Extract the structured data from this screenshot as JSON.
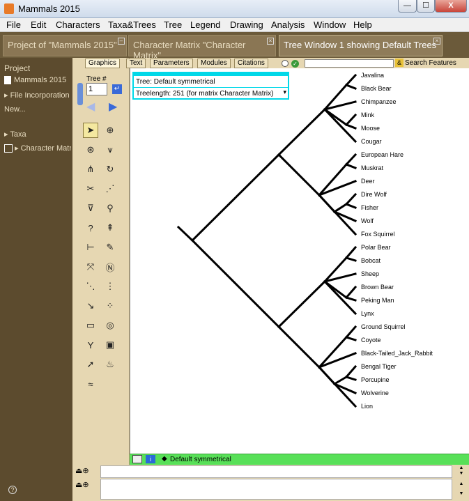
{
  "window": {
    "title": "Mammals 2015",
    "min_label": "—",
    "max_label": "☐",
    "close_label": "X"
  },
  "menu": [
    "File",
    "Edit",
    "Characters",
    "Taxa&Trees",
    "Tree",
    "Legend",
    "Drawing",
    "Analysis",
    "Window",
    "Help"
  ],
  "project_tabs": [
    {
      "label": "Project of \"Mammals 2015\""
    },
    {
      "label": "Character Matrix \"Character Matrix\""
    },
    {
      "label": "Tree Window 1 showing Default Trees"
    }
  ],
  "sidebar": {
    "project": "Project",
    "file": "Mammals 2015",
    "file_inc": "File Incorporation",
    "new": "New...",
    "taxa": "Taxa",
    "charmat": "Character Matrix"
  },
  "tree_num": {
    "label": "Tree #",
    "value": "1"
  },
  "subtabs": [
    "Graphics",
    "Text",
    "Parameters",
    "Modules",
    "Citations"
  ],
  "search": {
    "label": "Search Features",
    "value": ""
  },
  "tree_info": {
    "line1": "Tree: Default symmetrical",
    "line2": "Treelength: 251 (for matrix Character Matrix)"
  },
  "status": {
    "text": "Default symmetrical"
  },
  "colors": {
    "accent": "#00d8e8",
    "status_bg": "#58e058",
    "sidebar_bg": "#5c4b2e"
  },
  "taxa": [
    "Javalina",
    "Black Bear",
    "Chimpanzee",
    "Mink",
    "Moose",
    "Cougar",
    "European Hare",
    "Muskrat",
    "Deer",
    "Dire Wolf",
    "Fisher",
    "Wolf",
    "Fox Squirrel",
    "Polar Bear",
    "Bobcat",
    "Sheep",
    "Brown Bear",
    "Peking Man",
    "Lynx",
    "Ground Squirrel",
    "Coyote",
    "Black-Tailed_Jack_Rabbit",
    "Bengal Tiger",
    "Porcupine",
    "Wolverine",
    "Lion"
  ]
}
